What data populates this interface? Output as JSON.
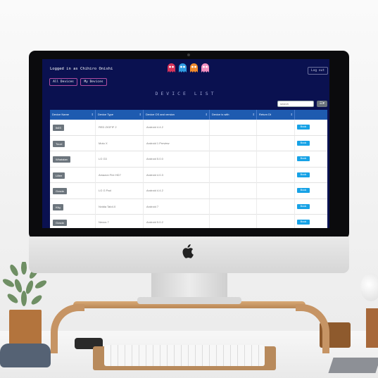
{
  "header": {
    "logged_in": "Logged in as Chihiro Onishi",
    "logout": "Log out",
    "ghost_colors": [
      "#d6335a",
      "#2f9be0",
      "#f08a2c",
      "#f28fc0"
    ]
  },
  "tabs": [
    {
      "label": "All Devices"
    },
    {
      "label": "My Devices"
    }
  ],
  "page_title": "DEVICE LIST",
  "search": {
    "placeholder": "search"
  },
  "table": {
    "headers": [
      "Device Name",
      "Device Type",
      "Device OS and version",
      "Device is with",
      "Return Dt",
      ""
    ],
    "rows": [
      {
        "name": "Ik6S",
        "type": "RED ZIGFIF 2",
        "os": "Android 4.4.2",
        "with": "",
        "return": "",
        "action": "Book"
      },
      {
        "name": "Toucl",
        "type": "Moto X",
        "os": "Android 1 Preview",
        "with": "",
        "return": "",
        "action": "Book"
      },
      {
        "name": "Whatalan",
        "type": "LG G3",
        "os": "Android 5.0.0",
        "with": "",
        "return": "",
        "action": "Book"
      },
      {
        "name": "Lillee",
        "type": "Amazon Fire HD7",
        "os": "Android 4.0.3",
        "with": "",
        "return": "",
        "action": "Book"
      },
      {
        "name": "Gosda",
        "type": "LG G Pad",
        "os": "Android 4.4.2",
        "with": "",
        "return": "",
        "action": "Book"
      },
      {
        "name": "Kilg",
        "type": "Nvidia Tab4.0",
        "os": "Android 7",
        "with": "",
        "return": "",
        "action": "Book"
      },
      {
        "name": "Gosda",
        "type": "Nexus 7",
        "os": "Android 5.0.2",
        "with": "",
        "return": "",
        "action": "Book"
      }
    ]
  }
}
